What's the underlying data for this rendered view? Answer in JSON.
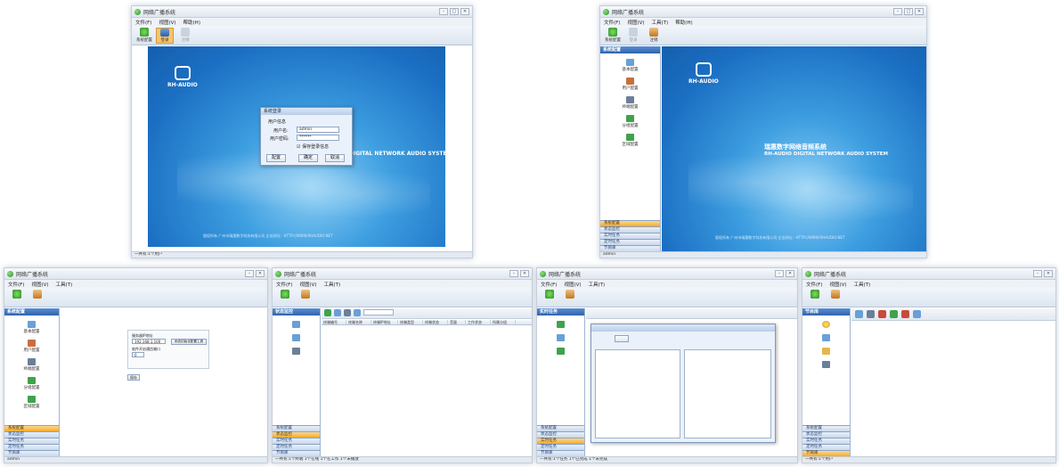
{
  "window_title": "网络广播系统",
  "menu": [
    "文件(F)",
    "视图(V)",
    "工具(T)",
    "帮助(H)"
  ],
  "toolbar": {
    "system_manage": "系统配置",
    "login": "登录",
    "logout": "注销"
  },
  "splash": {
    "logo_text": "RH-AUDIO",
    "system_name_cn": "瑞惠数字网络音频系统",
    "system_name_en": "RH-AUDIO DIGITAL NETWORK AUDIO SYSTEM",
    "footer": "版权所有 广州市瑞惠数字科技有限公司   企业网址：HTTP://WWW.RHAUDIO.NET"
  },
  "login_dialog": {
    "title": "系统登录",
    "section": "用户信息",
    "username_label": "用户名:",
    "username_value": "admin",
    "password_label": "用户密码:",
    "password_value": "******",
    "remember": "保存登录信息",
    "btn_config": "配置",
    "btn_ok": "确定",
    "btn_cancel": "取消"
  },
  "sidebar": {
    "header": "系统配置",
    "items": [
      "基本配置",
      "用户配置",
      "终端配置",
      "分组配置",
      "区域配置"
    ],
    "tabs": [
      "系统配置",
      "状态监控",
      "实时任务",
      "定时任务",
      "节目库"
    ]
  },
  "config_panel": {
    "server_label": "服务器IP地址",
    "server_ip": "192.168.1.100",
    "server_button": "系统初始化配置工具",
    "port_label": "软件开启通信端口",
    "port_value": "0",
    "save": "保存"
  },
  "grid_columns": [
    "终端编号",
    "终端名称",
    "终端IP地址",
    "终端类型",
    "终端状态",
    "音量",
    "工作状态",
    "所属分组"
  ],
  "status_texts": [
    "一共有:1个用户",
    "一共有:1个终端 1个在线 1个在工作 1个未播放",
    "一共有:1个任务 1个已完成 1个未完成"
  ],
  "colors": {
    "accent": "#2e63ad",
    "active_tab": "#f4a92c",
    "splash_blue": "#1b6fc3"
  }
}
